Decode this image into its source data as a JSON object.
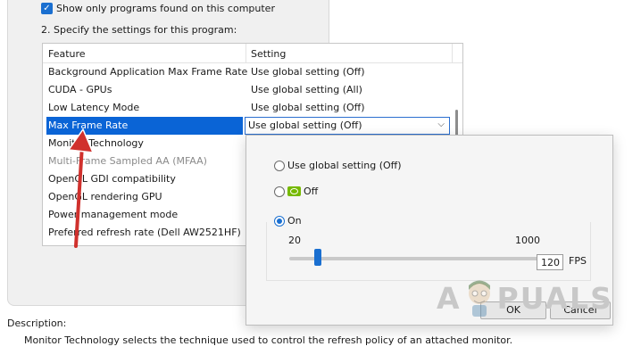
{
  "filter": {
    "checkbox_label": "Show only programs found on this computer",
    "checked": true
  },
  "step_label": "2. Specify the settings for this program:",
  "settings_table": {
    "columns": [
      "Feature",
      "Setting"
    ],
    "rows": [
      {
        "feature": "Background Application Max Frame Rate",
        "setting": "Use global setting (Off)"
      },
      {
        "feature": "CUDA - GPUs",
        "setting": "Use global setting (All)"
      },
      {
        "feature": "Low Latency Mode",
        "setting": "Use global setting (Off)"
      },
      {
        "feature": "Max Frame Rate",
        "setting": "Use global setting (Off)",
        "selected": true
      },
      {
        "feature": "Monitor Technology",
        "setting": ""
      },
      {
        "feature": "Multi-Frame Sampled AA (MFAA)",
        "setting": "",
        "disabled": true
      },
      {
        "feature": "OpenGL GDI compatibility",
        "setting": ""
      },
      {
        "feature": "OpenGL rendering GPU",
        "setting": ""
      },
      {
        "feature": "Power management mode",
        "setting": ""
      },
      {
        "feature": "Preferred refresh rate (Dell AW2521HF)",
        "setting": ""
      }
    ]
  },
  "popup": {
    "option_global": "Use global setting (Off)",
    "option_off": "Off",
    "option_on": "On",
    "selected_option": "On",
    "slider": {
      "min_label": "20",
      "max_label": "1000",
      "value": 120
    },
    "fps_value": "120",
    "fps_unit": "FPS",
    "ok_label": "OK",
    "cancel_label": "Cancel"
  },
  "description": {
    "label": "Description:",
    "text": "Monitor Technology selects the technique used to control the refresh policy of an attached monitor."
  },
  "watermark": {
    "left": "A",
    "right": "PUALS"
  },
  "colors": {
    "accent": "#0a64d6",
    "nvidia_green": "#76b900",
    "arrow_red": "#d0312d"
  }
}
